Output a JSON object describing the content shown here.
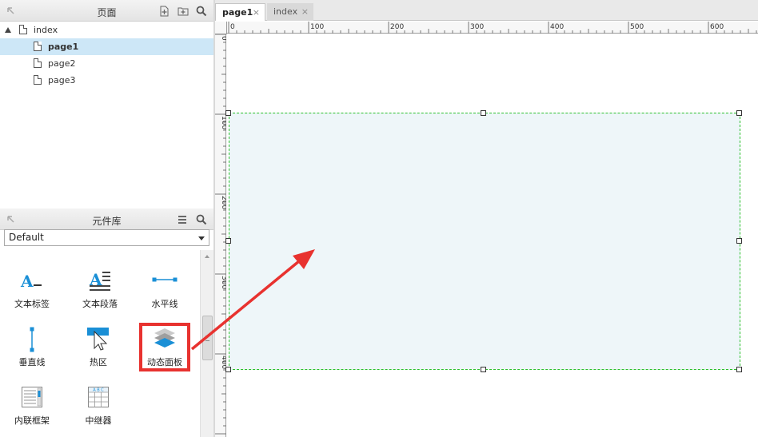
{
  "pages_panel": {
    "title": "页面",
    "items": [
      {
        "label": "index"
      },
      {
        "label": "page1"
      },
      {
        "label": "page2"
      },
      {
        "label": "page3"
      }
    ]
  },
  "library_panel": {
    "title": "元件库",
    "selected_library": "Default",
    "widgets": [
      {
        "label": "文本标签",
        "icon": "text-label-icon"
      },
      {
        "label": "文本段落",
        "icon": "text-paragraph-icon"
      },
      {
        "label": "水平线",
        "icon": "horizontal-line-icon"
      },
      {
        "label": "垂直线",
        "icon": "vertical-line-icon"
      },
      {
        "label": "热区",
        "icon": "hotspot-icon"
      },
      {
        "label": "动态面板",
        "icon": "dynamic-panel-icon"
      },
      {
        "label": "内联框架",
        "icon": "inline-frame-icon"
      },
      {
        "label": "中继器",
        "icon": "repeater-icon"
      }
    ],
    "text_label_glyph": "A",
    "paragraph_glyph": "A",
    "repeater_header_text": "A B C"
  },
  "tabs": [
    {
      "label": "page1",
      "close": "×"
    },
    {
      "label": "index",
      "close": "×"
    }
  ],
  "ruler": {
    "top_labels": [
      "0",
      "100",
      "200",
      "300",
      "400",
      "500",
      "600"
    ],
    "left_labels": [
      "0",
      "100",
      "200",
      "300",
      "400"
    ]
  },
  "colors": {
    "highlight": "#e8322f",
    "panel_fill": "#eef6f9",
    "selection_border": "#2bc02b",
    "selected_row": "#cde7f7",
    "icon_blue": "#1a8fd6"
  }
}
